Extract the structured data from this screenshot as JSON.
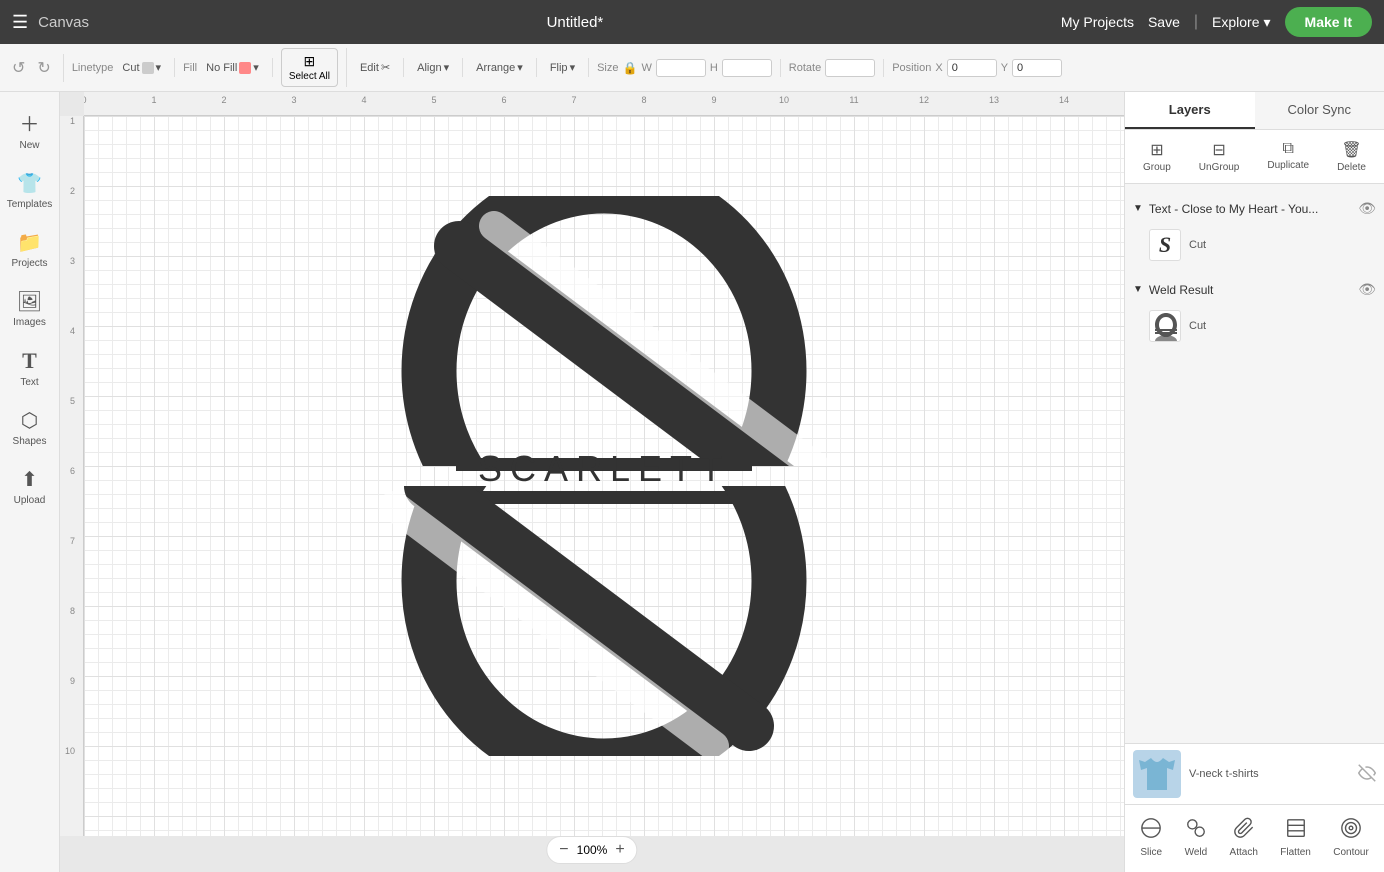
{
  "topbar": {
    "menu_label": "☰",
    "canvas_label": "Canvas",
    "title": "Untitled*",
    "my_projects_label": "My Projects",
    "save_label": "Save",
    "separator": "|",
    "explore_label": "Explore",
    "make_it_label": "Make It"
  },
  "toolbar": {
    "undo_label": "↺",
    "redo_label": "↻",
    "linetype_label": "Linetype",
    "linetype_val": "Cut",
    "fill_label": "Fill",
    "fill_val": "No Fill",
    "select_all_label": "Select All",
    "edit_label": "Edit",
    "align_label": "Align",
    "arrange_label": "Arrange",
    "flip_label": "Flip",
    "size_label": "Size",
    "w_label": "W",
    "h_label": "H",
    "rotate_label": "Rotate",
    "position_label": "Position",
    "x_label": "X",
    "x_val": "0",
    "y_label": "Y",
    "y_val": "0"
  },
  "sidebar": {
    "items": [
      {
        "label": "New",
        "icon": "＋"
      },
      {
        "label": "Templates",
        "icon": "👕"
      },
      {
        "label": "Projects",
        "icon": "📁"
      },
      {
        "label": "Images",
        "icon": "🖼"
      },
      {
        "label": "Text",
        "icon": "T"
      },
      {
        "label": "Shapes",
        "icon": "⬡"
      },
      {
        "label": "Upload",
        "icon": "⬆"
      }
    ]
  },
  "canvas": {
    "zoom_label": "100%",
    "zoom_minus": "−",
    "zoom_plus": "+"
  },
  "right_panel": {
    "tabs": [
      {
        "label": "Layers",
        "active": true
      },
      {
        "label": "Color Sync",
        "active": false
      }
    ],
    "actions": [
      {
        "label": "Group",
        "icon": "⊞",
        "disabled": false
      },
      {
        "label": "UnGroup",
        "icon": "⊟",
        "disabled": false
      },
      {
        "label": "Duplicate",
        "icon": "⧉",
        "disabled": false
      },
      {
        "label": "Delete",
        "icon": "🗑",
        "disabled": false
      }
    ],
    "layer_groups": [
      {
        "title": "Text - Close to My Heart - You...",
        "expanded": true,
        "items": [
          {
            "type": "text_s",
            "label": "Cut"
          }
        ]
      },
      {
        "title": "Weld Result",
        "expanded": true,
        "items": [
          {
            "type": "weld",
            "label": "Cut"
          }
        ]
      }
    ],
    "bottom_item": {
      "label": "V-neck t-shirts",
      "visible": false
    },
    "bottom_actions": [
      {
        "label": "Slice",
        "icon": "⊘"
      },
      {
        "label": "Weld",
        "icon": "⊕"
      },
      {
        "label": "Attach",
        "icon": "📎"
      },
      {
        "label": "Flatten",
        "icon": "⬚"
      },
      {
        "label": "Contour",
        "icon": "◎"
      }
    ]
  }
}
